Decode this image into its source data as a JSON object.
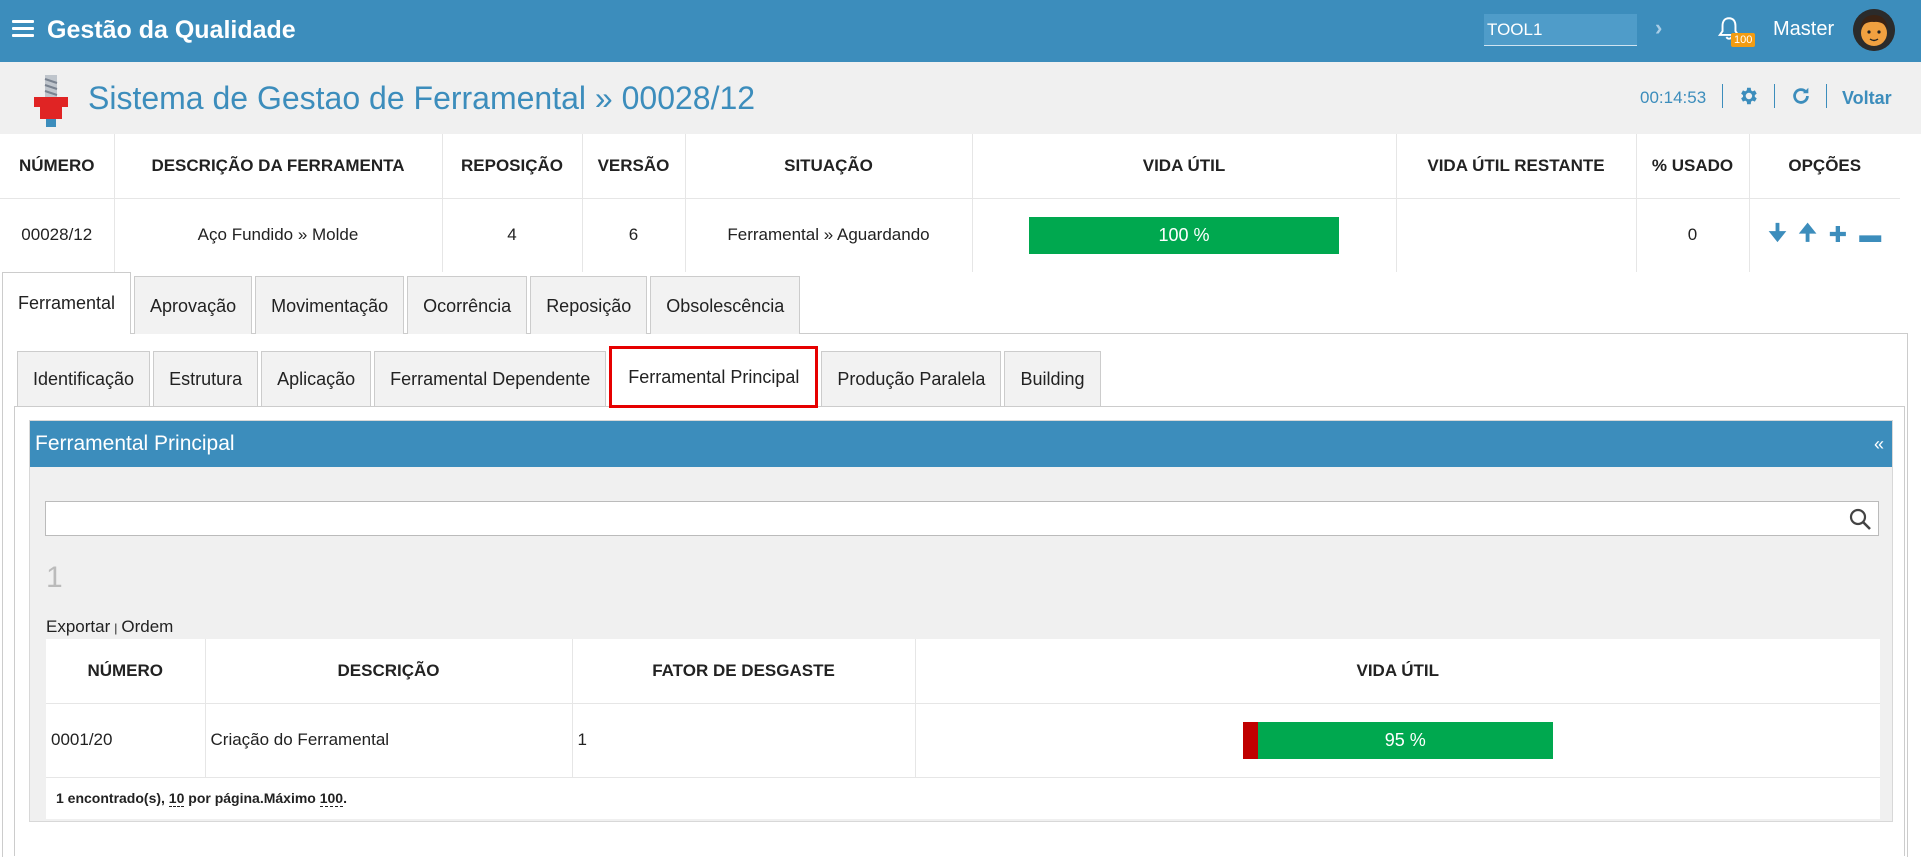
{
  "topbar": {
    "app_title": "Gestão da Qualidade",
    "tool_value": "TOOL1",
    "notification_count": "100",
    "user_name": "Master"
  },
  "header": {
    "title": "Sistema de Gestao de Ferramental » 00028/12",
    "timer": "00:14:53",
    "back_label": "Voltar"
  },
  "summary": {
    "columns": [
      "NÚMERO",
      "DESCRIÇÃO DA FERRAMENTA",
      "REPOSIÇÃO",
      "VERSÃO",
      "SITUAÇÃO",
      "VIDA ÚTIL",
      "VIDA ÚTIL RESTANTE",
      "% USADO",
      "OPÇÕES"
    ],
    "row": {
      "numero": "00028/12",
      "descricao": "Aço Fundido » Molde",
      "reposicao": "4",
      "versao": "6",
      "situacao": "Ferramental » Aguardando",
      "vida_util": "100 %",
      "vida_util_restante": "",
      "usado": "0"
    }
  },
  "outer_tabs": [
    "Ferramental",
    "Aprovação",
    "Movimentação",
    "Ocorrência",
    "Reposição",
    "Obsolescência"
  ],
  "inner_tabs": [
    "Identificação",
    "Estrutura",
    "Aplicação",
    "Ferramental Dependente",
    "Ferramental Principal",
    "Produção Paralela",
    "Building"
  ],
  "box": {
    "title": "Ferramental Principal",
    "collapse": "«",
    "search_value": "",
    "page_number": "1",
    "export_label": "Exportar",
    "order_label": "Ordem"
  },
  "grid": {
    "columns": [
      "NÚMERO",
      "DESCRIÇÃO",
      "FATOR DE DESGASTE",
      "VIDA ÚTIL"
    ],
    "rows": [
      {
        "numero": "0001/20",
        "descricao": "Criação do Ferramental",
        "fator": "1",
        "vida_util": "95 %"
      }
    ],
    "footer": {
      "found": "1 encontrado(s), ",
      "per_page_value": "10",
      "per_page_text": " por página.Máximo ",
      "max_value": "100",
      "end": "."
    }
  },
  "colors": {
    "primary": "#3c8dbc",
    "success": "#00a84f",
    "danger": "#c00000",
    "badge": "#f39c12",
    "highlight": "#e60000"
  }
}
